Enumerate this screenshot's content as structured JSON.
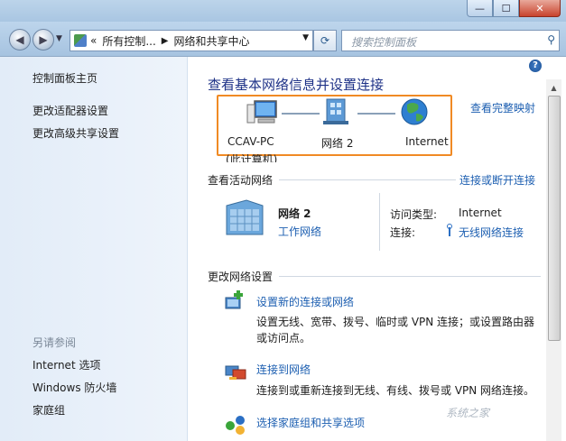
{
  "titlebar": {
    "min": "—",
    "max": "☐",
    "close": "✕"
  },
  "nav": {
    "back_icon": "back-arrow-icon",
    "forward_icon": "forward-arrow-icon",
    "breadcrumb_overflow": "«",
    "breadcrumb": [
      "所有控制...",
      "网络和共享中心"
    ],
    "refresh_icon": "refresh-icon",
    "search_placeholder": "搜索控制面板"
  },
  "sidebar": {
    "links": [
      "控制面板主页",
      "更改适配器设置",
      "更改高级共享设置"
    ],
    "see_also_header": "另请参阅",
    "see_also": [
      "Internet 选项",
      "Windows 防火墙",
      "家庭组"
    ]
  },
  "main": {
    "title": "查看基本网络信息并设置连接",
    "full_map_link": "查看完整映射",
    "map": {
      "pc_label": "CCAV-PC",
      "network_label": "网络  2",
      "internet_label": "Internet",
      "pc_sub": "(此计算机)"
    },
    "active_header": "查看活动网络",
    "connect_disconnect_link": "连接或断开连接",
    "active_network": {
      "name": "网络  2",
      "type_link": "工作网络",
      "access_type_label": "访问类型:",
      "access_type_value": "Internet",
      "connection_label": "连接:",
      "connection_value": "无线网络连接"
    },
    "change_header": "更改网络设置",
    "tasks": [
      {
        "link": "设置新的连接或网络",
        "desc1": "设置无线、宽带、拨号、临时或 VPN 连接；或设置路由器",
        "desc2": "或访问点。"
      },
      {
        "link": "连接到网络",
        "desc1": "连接到或重新连接到无线、有线、拨号或 VPN 网络连接。"
      },
      {
        "link": "选择家庭组和共享选项"
      }
    ]
  },
  "watermark": "系统之家"
}
